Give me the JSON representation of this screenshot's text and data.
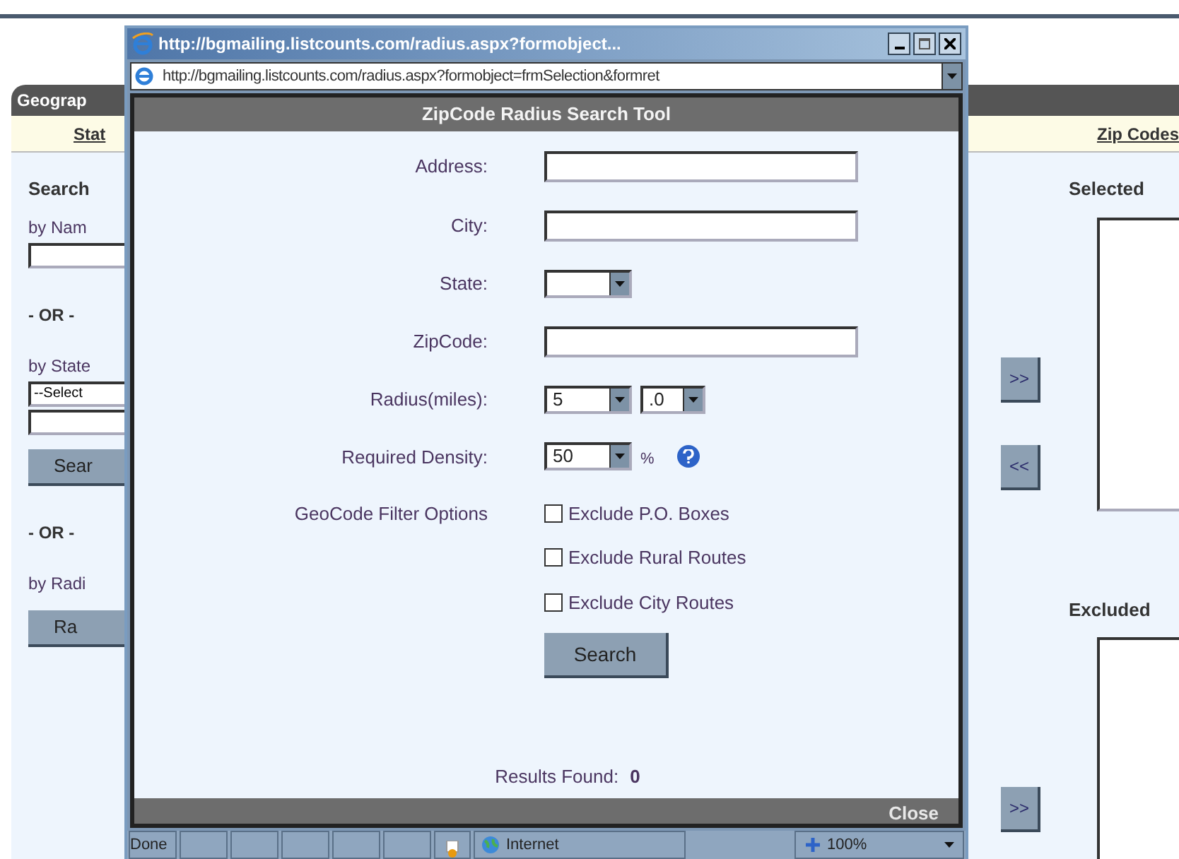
{
  "background_page": {
    "tab": "Geograp",
    "links": [
      {
        "label": "Stat"
      },
      {
        "label": "Zip Codes"
      }
    ],
    "left": [
      {
        "kind": "heading",
        "text": "Search"
      },
      {
        "kind": "label",
        "text": "by Nam"
      },
      {
        "kind": "input"
      },
      {
        "kind": "separator",
        "text": "- OR -"
      },
      {
        "kind": "label",
        "text": "by State"
      },
      {
        "kind": "select",
        "text": "--Select"
      },
      {
        "kind": "input"
      },
      {
        "kind": "button",
        "text": "Sear"
      },
      {
        "kind": "separator",
        "text": "- OR -"
      },
      {
        "kind": "label",
        "text": "by Radi"
      },
      {
        "kind": "button",
        "text": "Ra"
      }
    ],
    "arrows": [
      {
        "text": ">>"
      },
      {
        "text": "<<"
      },
      {
        "text": ">>"
      }
    ],
    "right": [
      {
        "heading": "Selected"
      },
      {
        "heading": "Excluded"
      }
    ]
  },
  "popup": {
    "title": "http://bgmailing.listcounts.com/radius.aspx?formobject...",
    "address": "http://bgmailing.listcounts.com/radius.aspx?formobject=frmSelection&formret",
    "header": "ZipCode Radius Search Tool",
    "fields": [
      {
        "label": "Address:",
        "kind": "text"
      },
      {
        "label": "City:",
        "kind": "text"
      },
      {
        "label": "State:",
        "kind": "select"
      },
      {
        "label": "ZipCode:",
        "kind": "text"
      },
      {
        "label": "Radius(miles):",
        "kind": "select",
        "selects": [
          "5",
          ".0"
        ]
      },
      {
        "label": "Required Density:",
        "kind": "select",
        "selects": [
          "50"
        ],
        "unit": "%",
        "help": true
      }
    ],
    "filters": {
      "label": "GeoCode Filter Options",
      "options": [
        {
          "label": "Exclude P.O. Boxes",
          "checked": false
        },
        {
          "label": "Exclude Rural Routes",
          "checked": false
        },
        {
          "label": "Exclude City Routes",
          "checked": false
        }
      ]
    },
    "search_button": "Search",
    "results": {
      "label": "Results Found:",
      "value": "0"
    },
    "close": "Close",
    "status_bar": {
      "text": "Done",
      "zone": "Internet",
      "zoom": "100%"
    }
  }
}
